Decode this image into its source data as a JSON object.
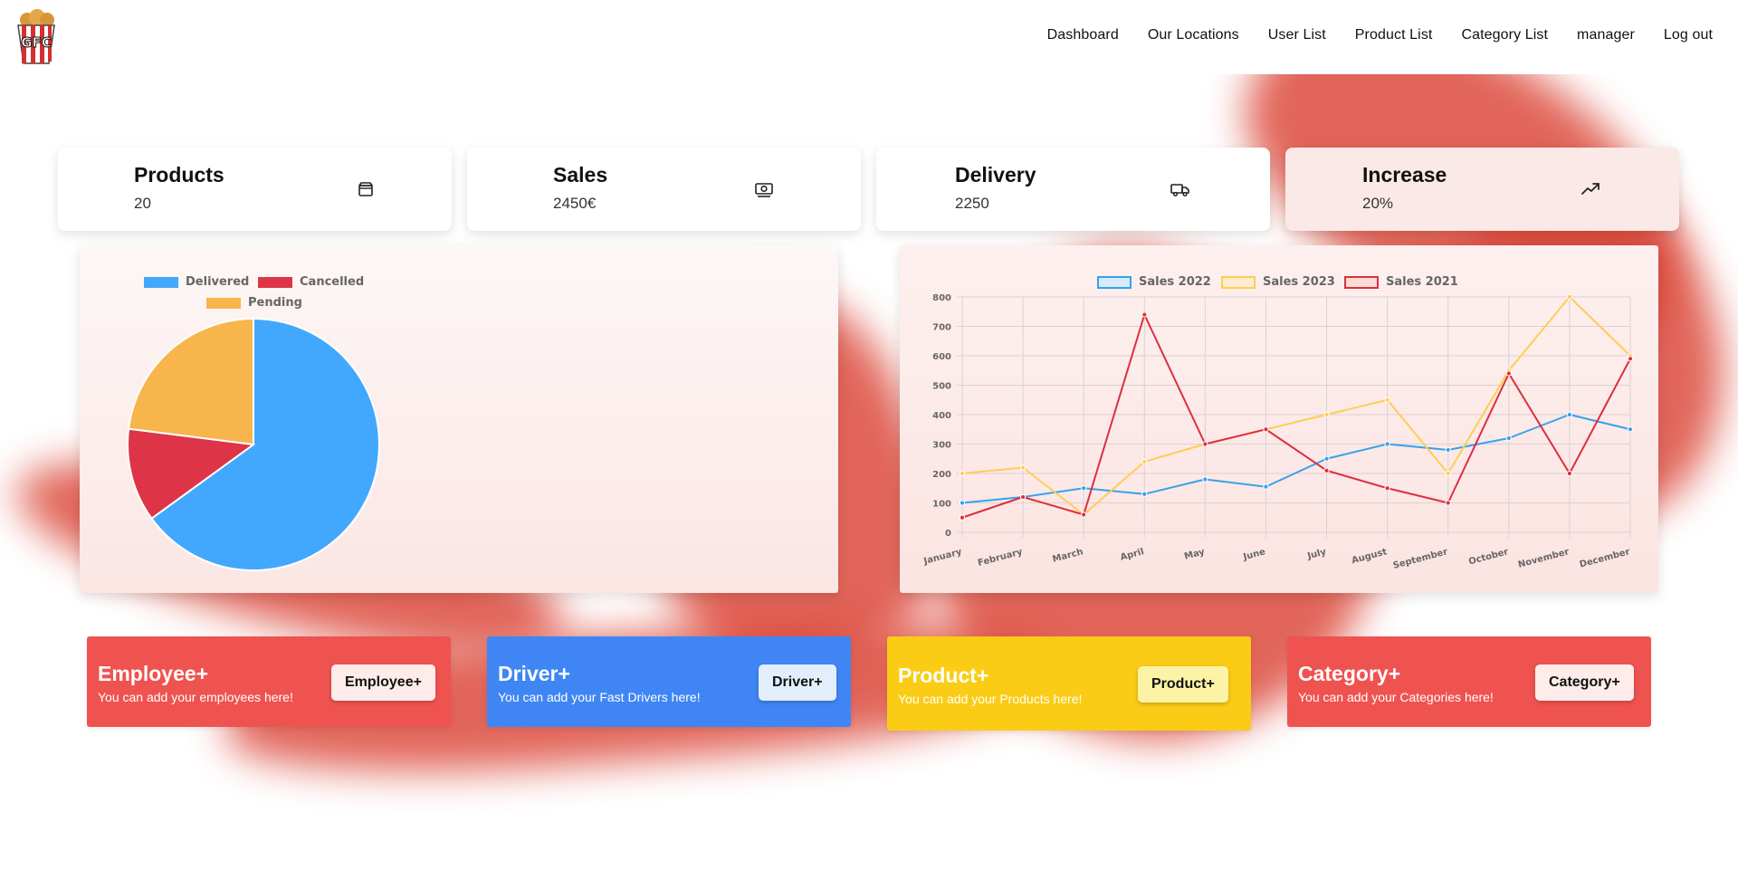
{
  "app": {
    "logo_text": "GFC"
  },
  "nav": [
    {
      "label": "Dashboard"
    },
    {
      "label": "Our Locations"
    },
    {
      "label": "User List"
    },
    {
      "label": "Product List"
    },
    {
      "label": "Category List"
    },
    {
      "label": "manager"
    },
    {
      "label": "Log out"
    }
  ],
  "stats": [
    {
      "title": "Products",
      "value": "20",
      "icon": "box-icon"
    },
    {
      "title": "Sales",
      "value": "2450€",
      "icon": "money-icon"
    },
    {
      "title": "Delivery",
      "value": "2250",
      "icon": "truck-icon"
    },
    {
      "title": "Increase",
      "value": "20%",
      "icon": "trending-up-icon"
    }
  ],
  "actions": [
    {
      "title": "Employee+",
      "subtitle": "You can add your employees here!",
      "button": "Employee+",
      "color": "#ef5350",
      "button_bg": "#fdecea"
    },
    {
      "title": "Driver+",
      "subtitle": "You can add your Fast Drivers here!",
      "button": "Driver+",
      "color": "#3f86f4",
      "button_bg": "#e3eefd"
    },
    {
      "title": "Product+",
      "subtitle": "You can add your Products here!",
      "button": "Product+",
      "color": "#facc15",
      "button_bg": "#fdf3a6"
    },
    {
      "title": "Category+",
      "subtitle": "You can add your Categories here!",
      "button": "Category+",
      "color": "#ef5350",
      "button_bg": "#fdecea"
    }
  ],
  "chart_data": [
    {
      "type": "pie",
      "title": "",
      "labels": [
        "Delivered",
        "Cancelled",
        "Pending"
      ],
      "values": [
        65,
        12,
        23
      ],
      "colors": [
        "#42a8fd",
        "#dd3547",
        "#f8b54c"
      ],
      "legend": "top"
    },
    {
      "type": "line",
      "title": "",
      "categories": [
        "January",
        "February",
        "March",
        "April",
        "May",
        "June",
        "July",
        "August",
        "September",
        "October",
        "November",
        "December"
      ],
      "series": [
        {
          "name": "Sales 2022",
          "color": "#36a2eb",
          "fill": "#d6ebfb",
          "values": [
            100,
            120,
            150,
            130,
            180,
            155,
            250,
            300,
            280,
            320,
            400,
            350
          ]
        },
        {
          "name": "Sales 2023",
          "color": "#ffcd56",
          "fill": "#fdeccd",
          "values": [
            200,
            220,
            60,
            240,
            300,
            350,
            400,
            450,
            200,
            550,
            800,
            600
          ]
        },
        {
          "name": "Sales 2021",
          "color": "#dd2f3f",
          "fill": "#fbdcd5",
          "values": [
            50,
            120,
            60,
            740,
            300,
            350,
            210,
            150,
            100,
            540,
            200,
            590
          ]
        }
      ],
      "ylim": [
        0,
        800
      ],
      "yticks": [
        0,
        100,
        200,
        300,
        400,
        500,
        600,
        700,
        800
      ],
      "grid": true,
      "legend": "top"
    }
  ]
}
